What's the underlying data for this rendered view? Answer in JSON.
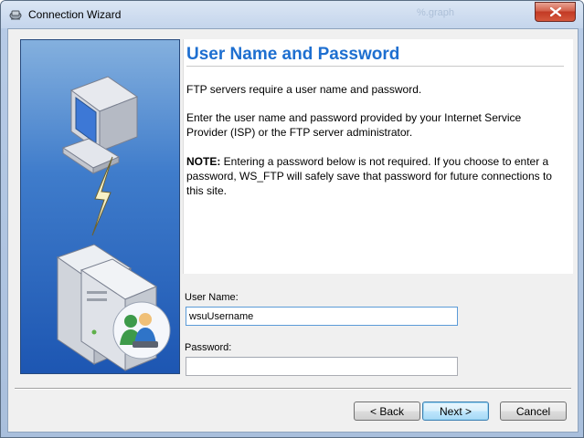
{
  "window": {
    "title": "Connection Wizard",
    "ghost_title": "%.graph"
  },
  "page": {
    "heading": "User Name and Password",
    "intro": "FTP servers require a user name and password.",
    "enter_text": "Enter the user name and password provided by your Internet Service Provider (ISP) or the FTP server administrator.",
    "note_label": "NOTE:",
    "note_text": " Entering a password below is not required. If you choose to enter a password, WS_FTP will safely save that password for future connections to this site."
  },
  "form": {
    "username_label": "User Name:",
    "username_value": "wsuUsername",
    "password_label": "Password:",
    "password_value": ""
  },
  "buttons": {
    "back": "< Back",
    "next": "Next >",
    "cancel": "Cancel"
  },
  "icons": [
    "app-icon",
    "close-icon",
    "computer-icon",
    "lightning-icon",
    "server-icon",
    "users-icon"
  ],
  "colors": {
    "heading": "#1e6fd0",
    "art_top": "#84b0de",
    "art_bottom": "#1d56b2",
    "close_button": "#c23a24"
  }
}
